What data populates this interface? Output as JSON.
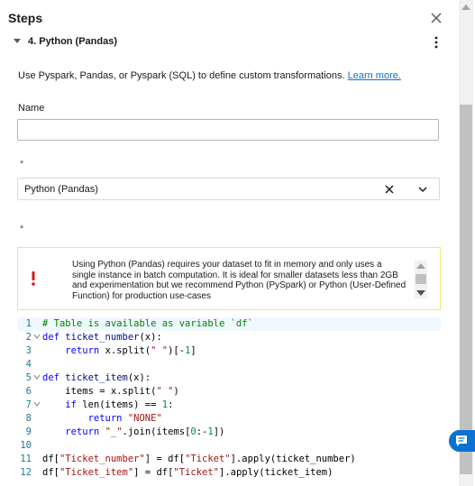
{
  "header": {
    "title": "Steps"
  },
  "step": {
    "label": "4. Python (Pandas)"
  },
  "description": {
    "text": "Use Pyspark, Pandas, or Pyspark (SQL) to define custom transformations. ",
    "link": "Learn more."
  },
  "name_field": {
    "label": "Name",
    "value": ""
  },
  "mode_field": {
    "asterisk": "*",
    "value": "Python (Pandas)"
  },
  "code_field": {
    "asterisk": "*"
  },
  "alert": {
    "text": "Using Python (Pandas) requires your dataset to fit in memory and only uses a single instance in batch computation. It is ideal for smaller datasets less than 2GB and experimentation but we recommend Python (PySpark) or Python (User-Defined Function) for production use-cases"
  },
  "colors": {
    "accent": "#0972d3",
    "alert_border": "#ece96c",
    "alert_icon": "#d91515"
  },
  "icons": {
    "close": "close-icon",
    "caret": "caret-down-icon",
    "kebab": "kebab-icon",
    "clear": "clear-icon",
    "chevron": "chevron-down-icon",
    "alert": "exclamation-icon",
    "chat": "chat-icon"
  },
  "code": {
    "line_numbers": [
      "1",
      "2",
      "3",
      "4",
      "5",
      "6",
      "7",
      "8",
      "9",
      "10",
      "11",
      "12"
    ]
  }
}
